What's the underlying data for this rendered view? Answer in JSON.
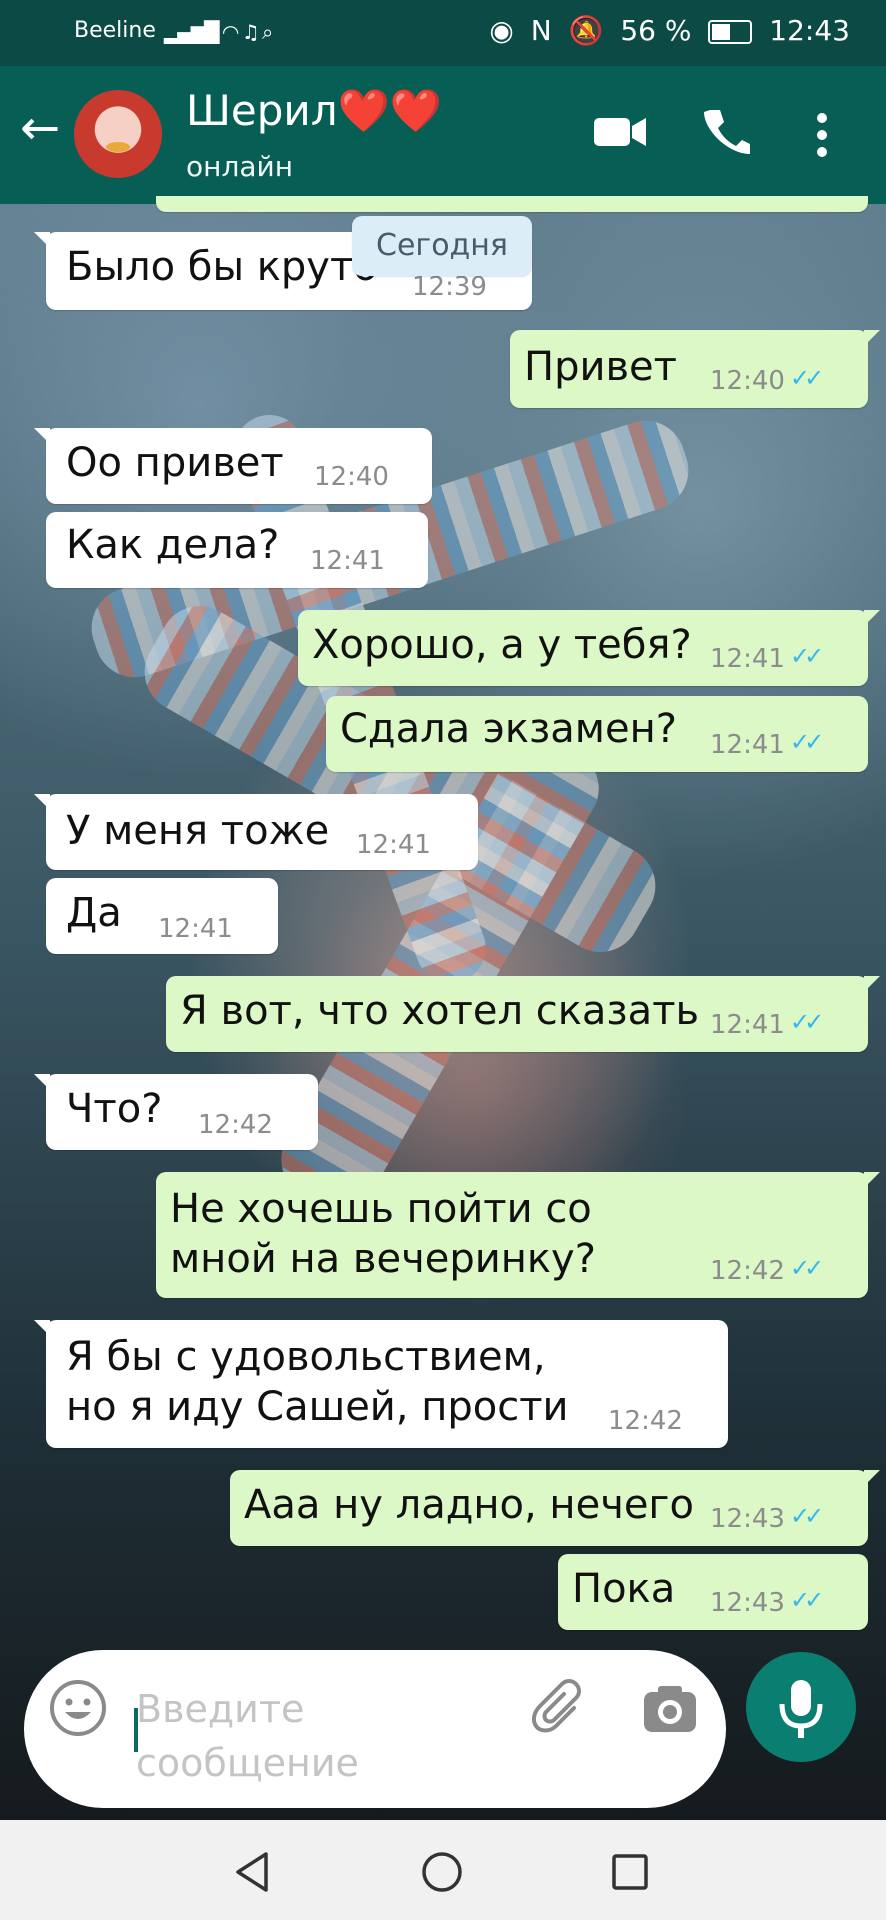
{
  "status_bar": {
    "carrier": "Beeline",
    "battery": "56 %",
    "time": "12:43"
  },
  "header": {
    "contact_name": "Шерил❤️❤️",
    "contact_status": "онлайн"
  },
  "date_chip": "Сегодня",
  "messages": [
    {
      "direction": "in",
      "text": "Было бы круто",
      "time": "12:39"
    },
    {
      "direction": "out",
      "text": "Привет",
      "time": "12:40"
    },
    {
      "direction": "in",
      "text": "Оо привет",
      "time": "12:40"
    },
    {
      "direction": "in",
      "text": "Как дела?",
      "time": "12:41"
    },
    {
      "direction": "out",
      "text": "Хорошо, а у тебя?",
      "time": "12:41"
    },
    {
      "direction": "out",
      "text": "Сдала экзамен?",
      "time": "12:41"
    },
    {
      "direction": "in",
      "text": "У меня тоже",
      "time": "12:41"
    },
    {
      "direction": "in",
      "text": "Да",
      "time": "12:41"
    },
    {
      "direction": "out",
      "text": "Я вот, что хотел сказать",
      "time": "12:41"
    },
    {
      "direction": "in",
      "text": "Что?",
      "time": "12:42"
    },
    {
      "direction": "out",
      "text_line1": " Не хочешь пойти со",
      "text_line2": "мной на вечеринку?",
      "time": "12:42"
    },
    {
      "direction": "in",
      "text_line1": "Я бы с удовольствием,",
      "text_line2": "но я иду Сашей, прости",
      "time": "12:42"
    },
    {
      "direction": "out",
      "text": "Ааа ну ладно, нечего",
      "time": "12:43"
    },
    {
      "direction": "out",
      "text": "Пока",
      "time": "12:43"
    }
  ],
  "composer": {
    "placeholder_line1": "Введите",
    "placeholder_line2": "сообщение"
  },
  "colors": {
    "header": "#075e54",
    "outgoing_bubble": "#dcf8c6",
    "incoming_bubble": "#ffffff",
    "read_ticks": "#34b7f1",
    "mic_button": "#0a7e70"
  }
}
